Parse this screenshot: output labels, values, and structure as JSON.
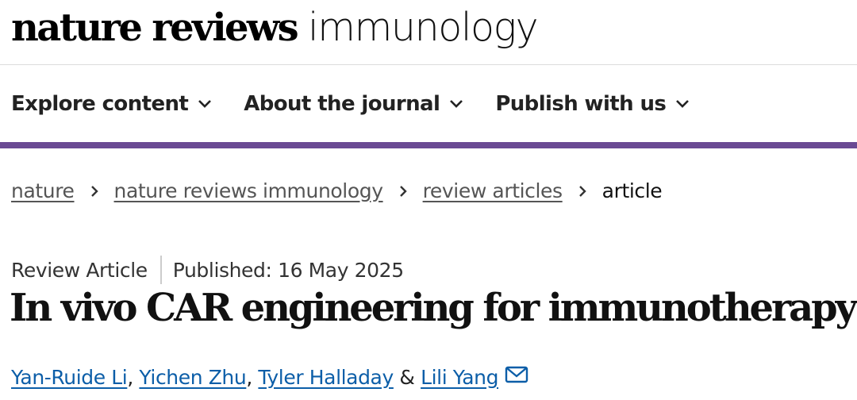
{
  "header": {
    "logo_bold": "nature reviews",
    "logo_light": "immunology"
  },
  "nav": {
    "items": [
      {
        "label": "Explore content",
        "icon": "chevron-down-icon"
      },
      {
        "label": "About the journal",
        "icon": "chevron-down-icon"
      },
      {
        "label": "Publish with us",
        "icon": "chevron-down-icon"
      }
    ]
  },
  "colors": {
    "accent": "#6a4a93",
    "link": "#0c5ea8"
  },
  "breadcrumb": {
    "items": [
      "nature",
      "nature reviews immunology",
      "review articles"
    ],
    "current": "article",
    "separator_icon": "chevron-right-icon"
  },
  "article": {
    "type": "Review Article",
    "published": "Published: 16 May 2025",
    "title": "In vivo CAR engineering for immunotherapy",
    "authors": [
      "Yan-Ruide Li",
      "Yichen Zhu",
      "Tyler Halladay",
      "Lili Yang"
    ],
    "separators": [
      ",",
      ",",
      "&"
    ],
    "contact_icon": "mail-icon"
  }
}
